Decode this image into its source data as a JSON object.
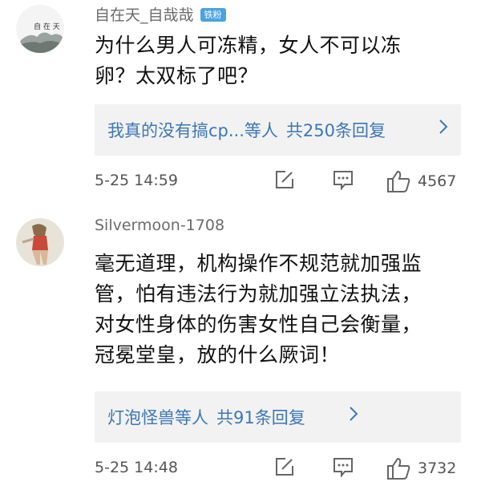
{
  "comments": [
    {
      "username": "自在天_自哉哉",
      "badge": "铁粉",
      "avatar_text": "自 在 天",
      "text_lines": [
        "为什么男人可冻精，女人不可以冻",
        "卵？太双标了吧？"
      ],
      "reply": {
        "names": "我真的没有搞cp...等人",
        "count": "共250条回复"
      },
      "time": "5-25 14:59",
      "likes": "4567"
    },
    {
      "username": "Silvermoon-1708",
      "text_lines": [
        "毫无道理，机构操作不规范就加强监",
        "管，怕有违法行为就加强立法执法，",
        "对女性身体的伤害女性自己会衡量，",
        "冠冕堂皇，放的什么厥词！"
      ],
      "reply": {
        "names": "灯泡怪兽等人",
        "count": "共91条回复"
      },
      "time": "5-25 14:48",
      "likes": "3732"
    }
  ],
  "icons": {
    "edit": "edit-icon",
    "comment": "comment-icon",
    "like": "thumbs-up-icon",
    "chevron": "chevron-right-icon"
  },
  "colors": {
    "link": "#3d77b5",
    "badge": "#4aa3df",
    "reply_bg": "#f2f2f2"
  }
}
